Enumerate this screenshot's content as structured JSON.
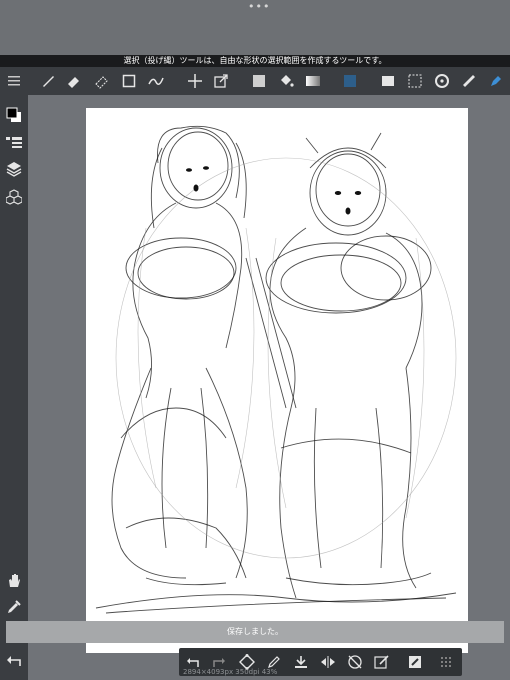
{
  "hint_text": "選択（投げ縄）ツールは、自由な形状の選択範囲を作成するツールです。",
  "toast_text": "保存しました。",
  "status_text": "2894×4093px 350dpi 43%",
  "colors": {
    "toolbar_bg": "#3a3d41",
    "accent": "#3d8fd6"
  },
  "toolbar_icons": [
    "menu-icon",
    "brush-icon",
    "eraser-icon",
    "lasso-eraser-icon",
    "rectangle-icon",
    "vector-pen-icon",
    "move-icon",
    "transform-icon",
    "fill-color-icon",
    "bucket-icon",
    "gradient-icon",
    "selection-layer-icon",
    "screen-icon",
    "lasso-select-icon",
    "rotate-icon",
    "ruler-icon",
    "pen-tool-icon"
  ],
  "sidebar_icons": [
    "color-swatch-icon",
    "sub-tool-icon",
    "layers-icon",
    "material-icon",
    "hand-icon",
    "eyedropper-icon",
    "undo-icon"
  ],
  "bottom_icons": [
    "undo-icon",
    "redo-icon",
    "transform-icon",
    "pen-icon",
    "import-icon",
    "flip-icon",
    "rotate-lock-icon",
    "edit-icon",
    "ai-color-icon",
    "grid-icon"
  ]
}
